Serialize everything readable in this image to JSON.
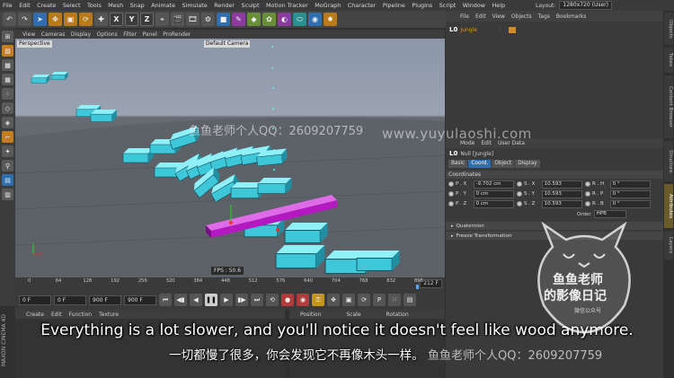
{
  "menu": [
    "File",
    "Edit",
    "Create",
    "Select",
    "Tools",
    "Mesh",
    "Snap",
    "Animate",
    "Simulate",
    "Render",
    "Sculpt",
    "Motion Tracker",
    "MoGraph",
    "Character",
    "Pipeline",
    "Plugins",
    "Script",
    "Window",
    "Help"
  ],
  "layout": {
    "label": "Layout:",
    "value": "1280x720 (User)"
  },
  "toolbar": {
    "axis_x": "X",
    "axis_y": "Y",
    "axis_z": "Z"
  },
  "viewport": {
    "menu": [
      "View",
      "Cameras",
      "Display",
      "Options",
      "Filter",
      "Panel",
      "ProRender"
    ],
    "perspective_label": "Perspective",
    "camera_label": "Default Camera",
    "fps": "FPS : 50.6"
  },
  "timeline": {
    "ticks": [
      "0",
      "64",
      "128",
      "192",
      "256",
      "320",
      "384",
      "448",
      "512",
      "576",
      "640",
      "704",
      "768",
      "832",
      "896"
    ],
    "current_frame": "212 F",
    "start_field": "0 F",
    "min_field": "0 F",
    "end_field": "900 F",
    "max_field": "900 F"
  },
  "material_panel": {
    "menu": [
      "Create",
      "Edit",
      "Function",
      "Texture"
    ]
  },
  "coord_panel": {
    "headers": [
      "Position",
      "Scale",
      "Rotation"
    ]
  },
  "object_manager": {
    "menu": [
      "File",
      "Edit",
      "View",
      "Objects",
      "Tags",
      "Bookmarks"
    ],
    "object_name": "Jungle"
  },
  "attribute_manager": {
    "menu": [
      "Mode",
      "Edit",
      "User Data"
    ],
    "title": "Null [Jungle]",
    "tabs": [
      "Basic",
      "Coord.",
      "Object",
      "Display"
    ],
    "active_tab": "Coord.",
    "section": "Coordinates",
    "rows": [
      {
        "p_label": "P . X",
        "p_val": "-9.702 cm",
        "s_label": "S . X",
        "s_val": "10.593",
        "r_label": "R . H",
        "r_val": "0 °"
      },
      {
        "p_label": "P . Y",
        "p_val": "0 cm",
        "s_label": "S . Y",
        "s_val": "10.593",
        "r_label": "R . P",
        "r_val": "0 °"
      },
      {
        "p_label": "P . Z",
        "p_val": "0 cm",
        "s_label": "S . Z",
        "s_val": "10.593",
        "r_label": "R . B",
        "r_val": "0 °"
      }
    ],
    "order_label": "Order",
    "order_value": "HPB",
    "folds": [
      "Quaternion",
      "Freeze Transformation"
    ]
  },
  "right_tabs": [
    "Objects",
    "Takes",
    "Content Browser",
    "Structure",
    "Attributes",
    "Layers"
  ],
  "active_right_tab": "Attributes",
  "watermark_cn": "鱼鱼老师个人QQ：2609207759",
  "watermark_url": "www.yuyulaoshi.com",
  "subtitle_en": "Everything is a lot slower, and you'll notice it doesn't feel like wood anymore.",
  "subtitle_cn": "一切都慢了很多，你会发现它不再像木头一样。",
  "bottom_watermark": "鱼鱼老师个人QQ：2609207759",
  "stamp_line1": "鱼鱼老师",
  "stamp_line2": "的影像日记",
  "stamp_line3": "微信公众号",
  "maxon": "MAXON CINEMA 4D",
  "colors": {
    "accent": "#2f6fb0",
    "cubes": "#3ec6d9",
    "bar": "#b418c0",
    "orange": "#e08c2a"
  }
}
